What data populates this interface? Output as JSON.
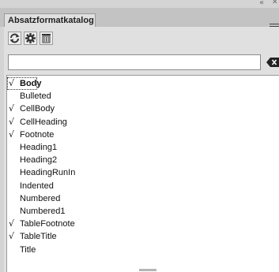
{
  "panel": {
    "tab_label": "Absatzformatkatalog",
    "collapse_icon": "double-chevron-left-icon",
    "close_icon": "close-icon",
    "menu_icon": "panel-menu-icon"
  },
  "toolbar": {
    "buttons": [
      "refresh-icon",
      "gear-icon",
      "trash-icon"
    ]
  },
  "search": {
    "value": "",
    "placeholder": ""
  },
  "styles": [
    {
      "name": "Body",
      "checked": true,
      "selected": true
    },
    {
      "name": "Bulleted",
      "checked": false
    },
    {
      "name": "CellBody",
      "checked": true
    },
    {
      "name": "CellHeading",
      "checked": true
    },
    {
      "name": "Footnote",
      "checked": true
    },
    {
      "name": "Heading1",
      "checked": false
    },
    {
      "name": "Heading2",
      "checked": false
    },
    {
      "name": "HeadingRunIn",
      "checked": false
    },
    {
      "name": "Indented",
      "checked": false
    },
    {
      "name": "Numbered",
      "checked": false
    },
    {
      "name": "Numbered1",
      "checked": false
    },
    {
      "name": "TableFootnote",
      "checked": true
    },
    {
      "name": "TableTitle",
      "checked": true
    },
    {
      "name": "Title",
      "checked": false
    }
  ],
  "check_mark": "√"
}
